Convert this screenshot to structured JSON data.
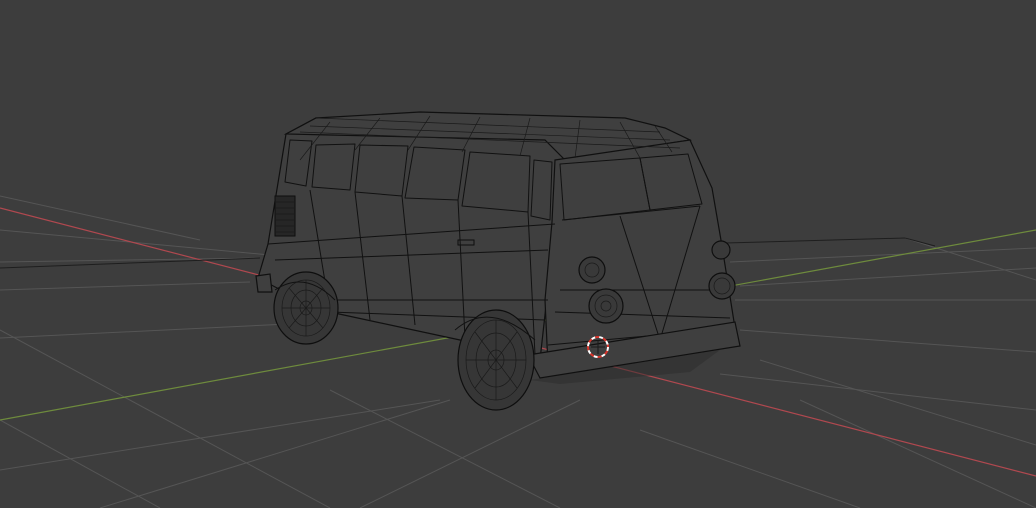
{
  "viewport": {
    "background_color": "#3d3d3d",
    "grid_color": "#555555",
    "x_axis_color": "#b0484f",
    "y_axis_color": "#6e8b3d",
    "wireframe_color": "#111111",
    "cursor_ring_colors": [
      "#ffffff",
      "#d9342b"
    ]
  },
  "scene": {
    "object": "van-wireframe-model",
    "shading_mode": "wireframe",
    "icons": [
      "3d-cursor-icon"
    ]
  }
}
